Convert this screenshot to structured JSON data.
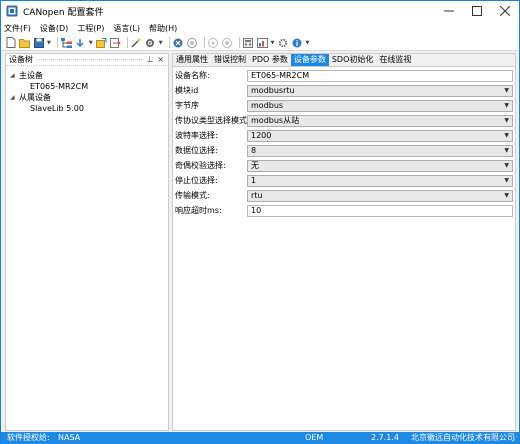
{
  "window": {
    "title": "CANopen 配置套件"
  },
  "menu": [
    "文件(F)",
    "设备(D)",
    "工程(P)",
    "语言(L)",
    "帮助(H)"
  ],
  "left_panel": {
    "title": "设备树",
    "pin": "⊥",
    "close": "×",
    "tree": {
      "master_label": "主设备",
      "master_child": "ET065-MR2CM",
      "slave_label": "从属设备",
      "slave_child": "SlaveLib 5.00"
    }
  },
  "tabs": [
    "通用属性",
    "错误控制",
    "PDO 参数",
    "设备参数",
    "SDO初始化",
    "在线监视"
  ],
  "active_tab": "设备参数",
  "params": {
    "device_name": {
      "label": "设备名称:",
      "value": "ET065-MR2CM"
    },
    "module_id": {
      "label": "模块id",
      "value": "modbusrtu"
    },
    "byte_order": {
      "label": "字节序",
      "value": "modbus"
    },
    "protocol_mode": {
      "label": "传协议类型选择模式:",
      "value": "modbus从站"
    },
    "baud_rate": {
      "label": "波特率选择:",
      "value": "1200"
    },
    "data_bits": {
      "label": "数据位选择:",
      "value": "8"
    },
    "parity": {
      "label": "奇偶校验选择:",
      "value": "无"
    },
    "stop_bits": {
      "label": "停止位选择:",
      "value": "1"
    },
    "transfer_mode": {
      "label": "传输模式:",
      "value": "rtu"
    },
    "response_timeout": {
      "label": "响应超时ms:",
      "value": "10"
    }
  },
  "status": {
    "license_label": "软件授权给:",
    "license_value": "NASA",
    "mode": "OEM",
    "version": "2.7.1.4",
    "company": "北京徽远自动化技术有限公司"
  },
  "colors": {
    "accent": "#1e88e5",
    "window_border": "#1883d7",
    "select_bg": "#e8e8e8",
    "statusbar_text": "#ffffff"
  }
}
